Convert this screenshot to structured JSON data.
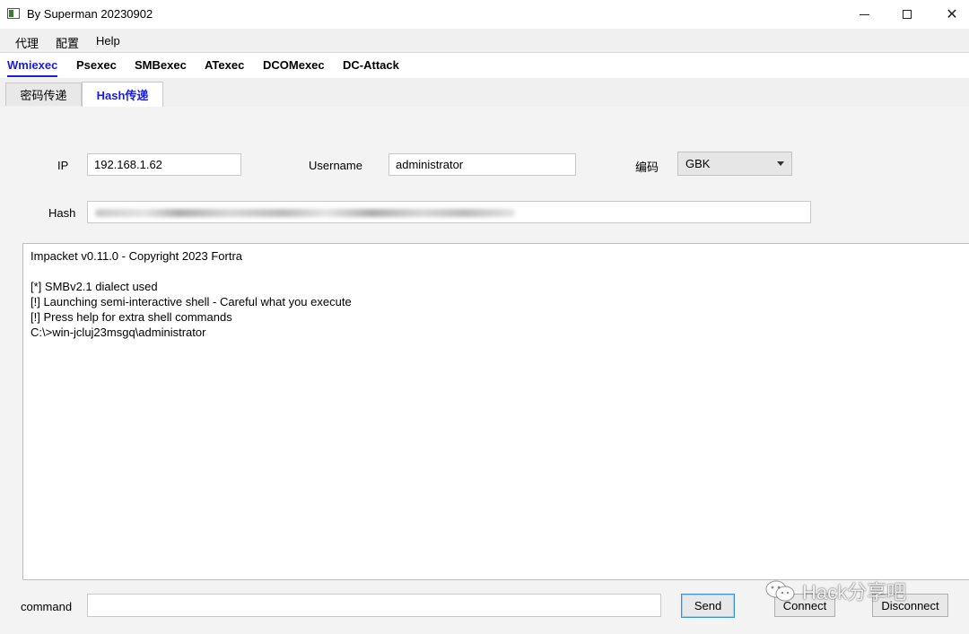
{
  "window": {
    "title": "By Superman 20230902",
    "controls": {
      "minimize": "—",
      "maximize": "☐",
      "close": "✕"
    }
  },
  "menu": [
    "代理",
    "配置",
    "Help"
  ],
  "tool_tabs": [
    "Wmiexec",
    "Psexec",
    "SMBexec",
    "ATexec",
    "DCOMexec",
    "DC-Attack"
  ],
  "active_tool_tab": "Wmiexec",
  "sub_tabs": [
    "密码传递",
    "Hash传递"
  ],
  "active_sub_tab": "Hash传递",
  "form": {
    "ip_label": "IP",
    "ip_value": "192.168.1.62",
    "username_label": "Username",
    "username_value": "administrator",
    "encoding_label": "编码",
    "encoding_value": "GBK",
    "hash_label": "Hash"
  },
  "console": {
    "lines": [
      "Impacket v0.11.0 - Copyright 2023 Fortra",
      "",
      "[*] SMBv2.1 dialect used",
      "[!] Launching semi-interactive shell - Careful what you execute",
      "[!] Press help for extra shell commands",
      "C:\\>win-jcluj23msgq\\administrator"
    ]
  },
  "command": {
    "label": "command",
    "value": ""
  },
  "buttons": {
    "send": "Send",
    "connect": "Connect",
    "disconnect": "Disconnect"
  },
  "watermark": {
    "text": "Hack分享吧",
    "icon": "wechat-icon"
  },
  "colors": {
    "accent": "#1a1ae6",
    "default_button_border": "#3c8fd6"
  }
}
